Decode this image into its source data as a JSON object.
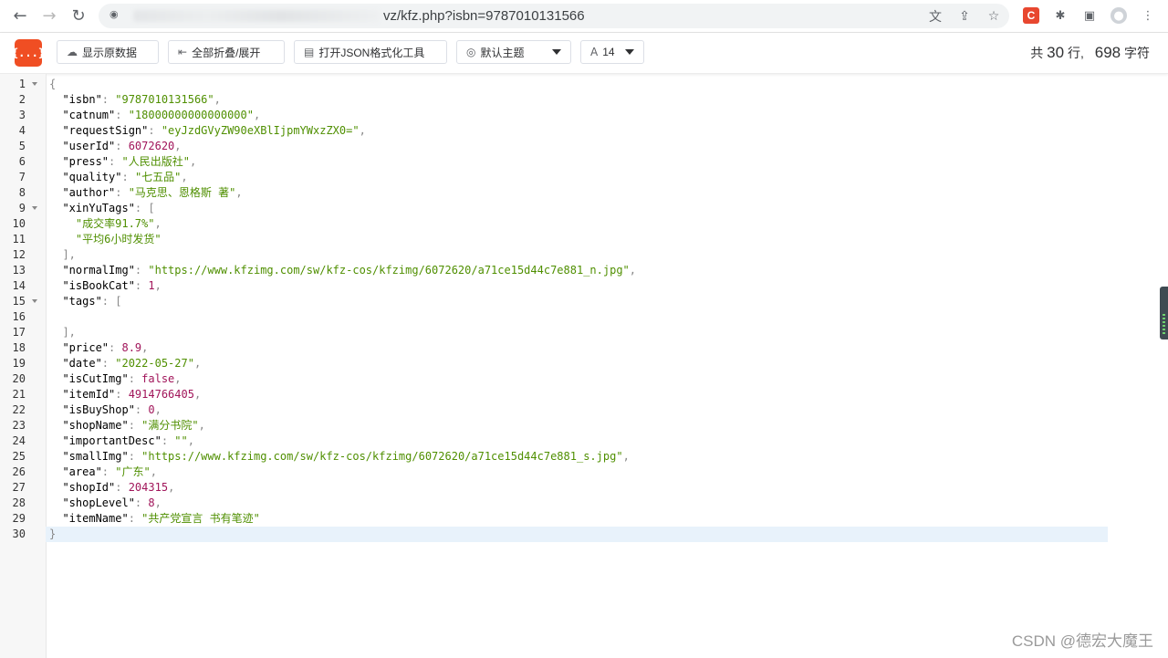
{
  "browser": {
    "url": "vz/kfz.php?isbn=9787010131566",
    "nav": {
      "back": "←",
      "forward": "→",
      "reload": "↻"
    },
    "omni_icons": [
      "translate-icon",
      "share-icon",
      "star-icon"
    ],
    "ext_c_label": "C"
  },
  "toolbar": {
    "logo": "{...}",
    "raw_label": "显示原数据",
    "fold_label": "全部折叠/展开",
    "format_label": "打开JSON格式化工具",
    "theme_label": "默认主题",
    "font_size_label": "14",
    "stats_prefix": "共",
    "stats_lines": "30",
    "stats_lines_unit": "行,",
    "stats_chars": "698",
    "stats_chars_unit": "字符"
  },
  "editor": {
    "lines": [
      [
        [
          "p",
          "{"
        ]
      ],
      [
        [
          "k",
          "  \"isbn\""
        ],
        [
          "p",
          ": "
        ],
        [
          "s",
          "\"9787010131566\""
        ],
        [
          "p",
          ","
        ]
      ],
      [
        [
          "k",
          "  \"catnum\""
        ],
        [
          "p",
          ": "
        ],
        [
          "s",
          "\"18000000000000000\""
        ],
        [
          "p",
          ","
        ]
      ],
      [
        [
          "k",
          "  \"requestSign\""
        ],
        [
          "p",
          ": "
        ],
        [
          "s",
          "\"eyJzdGVyZW90eXBlIjpmYWxzZX0=\""
        ],
        [
          "p",
          ","
        ]
      ],
      [
        [
          "k",
          "  \"userId\""
        ],
        [
          "p",
          ": "
        ],
        [
          "n",
          "6072620"
        ],
        [
          "p",
          ","
        ]
      ],
      [
        [
          "k",
          "  \"press\""
        ],
        [
          "p",
          ": "
        ],
        [
          "s",
          "\"人民出版社\""
        ],
        [
          "p",
          ","
        ]
      ],
      [
        [
          "k",
          "  \"quality\""
        ],
        [
          "p",
          ": "
        ],
        [
          "s",
          "\"七五品\""
        ],
        [
          "p",
          ","
        ]
      ],
      [
        [
          "k",
          "  \"author\""
        ],
        [
          "p",
          ": "
        ],
        [
          "s",
          "\"马克思、恩格斯 著\""
        ],
        [
          "p",
          ","
        ]
      ],
      [
        [
          "k",
          "  \"xinYuTags\""
        ],
        [
          "p",
          ": ["
        ]
      ],
      [
        [
          "s",
          "    \"成交率91.7%\""
        ],
        [
          "p",
          ","
        ]
      ],
      [
        [
          "s",
          "    \"平均6小时发货\""
        ]
      ],
      [
        [
          "p",
          "  ],"
        ]
      ],
      [
        [
          "k",
          "  \"normalImg\""
        ],
        [
          "p",
          ": "
        ],
        [
          "s",
          "\"https://www.kfzimg.com/sw/kfz-cos/kfzimg/6072620/a71ce15d44c7e881_n.jpg\""
        ],
        [
          "p",
          ","
        ]
      ],
      [
        [
          "k",
          "  \"isBookCat\""
        ],
        [
          "p",
          ": "
        ],
        [
          "n",
          "1"
        ],
        [
          "p",
          ","
        ]
      ],
      [
        [
          "k",
          "  \"tags\""
        ],
        [
          "p",
          ": ["
        ]
      ],
      [
        [
          "p",
          " "
        ]
      ],
      [
        [
          "p",
          "  ],"
        ]
      ],
      [
        [
          "k",
          "  \"price\""
        ],
        [
          "p",
          ": "
        ],
        [
          "n",
          "8.9"
        ],
        [
          "p",
          ","
        ]
      ],
      [
        [
          "k",
          "  \"date\""
        ],
        [
          "p",
          ": "
        ],
        [
          "s",
          "\"2022-05-27\""
        ],
        [
          "p",
          ","
        ]
      ],
      [
        [
          "k",
          "  \"isCutImg\""
        ],
        [
          "p",
          ": "
        ],
        [
          "n",
          "false"
        ],
        [
          "p",
          ","
        ]
      ],
      [
        [
          "k",
          "  \"itemId\""
        ],
        [
          "p",
          ": "
        ],
        [
          "n",
          "4914766405"
        ],
        [
          "p",
          ","
        ]
      ],
      [
        [
          "k",
          "  \"isBuyShop\""
        ],
        [
          "p",
          ": "
        ],
        [
          "n",
          "0"
        ],
        [
          "p",
          ","
        ]
      ],
      [
        [
          "k",
          "  \"shopName\""
        ],
        [
          "p",
          ": "
        ],
        [
          "s",
          "\"满分书院\""
        ],
        [
          "p",
          ","
        ]
      ],
      [
        [
          "k",
          "  \"importantDesc\""
        ],
        [
          "p",
          ": "
        ],
        [
          "s",
          "\"\""
        ],
        [
          "p",
          ","
        ]
      ],
      [
        [
          "k",
          "  \"smallImg\""
        ],
        [
          "p",
          ": "
        ],
        [
          "s",
          "\"https://www.kfzimg.com/sw/kfz-cos/kfzimg/6072620/a71ce15d44c7e881_s.jpg\""
        ],
        [
          "p",
          ","
        ]
      ],
      [
        [
          "k",
          "  \"area\""
        ],
        [
          "p",
          ": "
        ],
        [
          "s",
          "\"广东\""
        ],
        [
          "p",
          ","
        ]
      ],
      [
        [
          "k",
          "  \"shopId\""
        ],
        [
          "p",
          ": "
        ],
        [
          "n",
          "204315"
        ],
        [
          "p",
          ","
        ]
      ],
      [
        [
          "k",
          "  \"shopLevel\""
        ],
        [
          "p",
          ": "
        ],
        [
          "n",
          "8"
        ],
        [
          "p",
          ","
        ]
      ],
      [
        [
          "k",
          "  \"itemName\""
        ],
        [
          "p",
          ": "
        ],
        [
          "s",
          "\"共产党宣言 书有笔迹\""
        ]
      ],
      [
        [
          "p",
          "}"
        ]
      ]
    ],
    "fold_lines": [
      1,
      9,
      15
    ],
    "active_line": 30
  },
  "watermark": "CSDN @德宏大魔王"
}
